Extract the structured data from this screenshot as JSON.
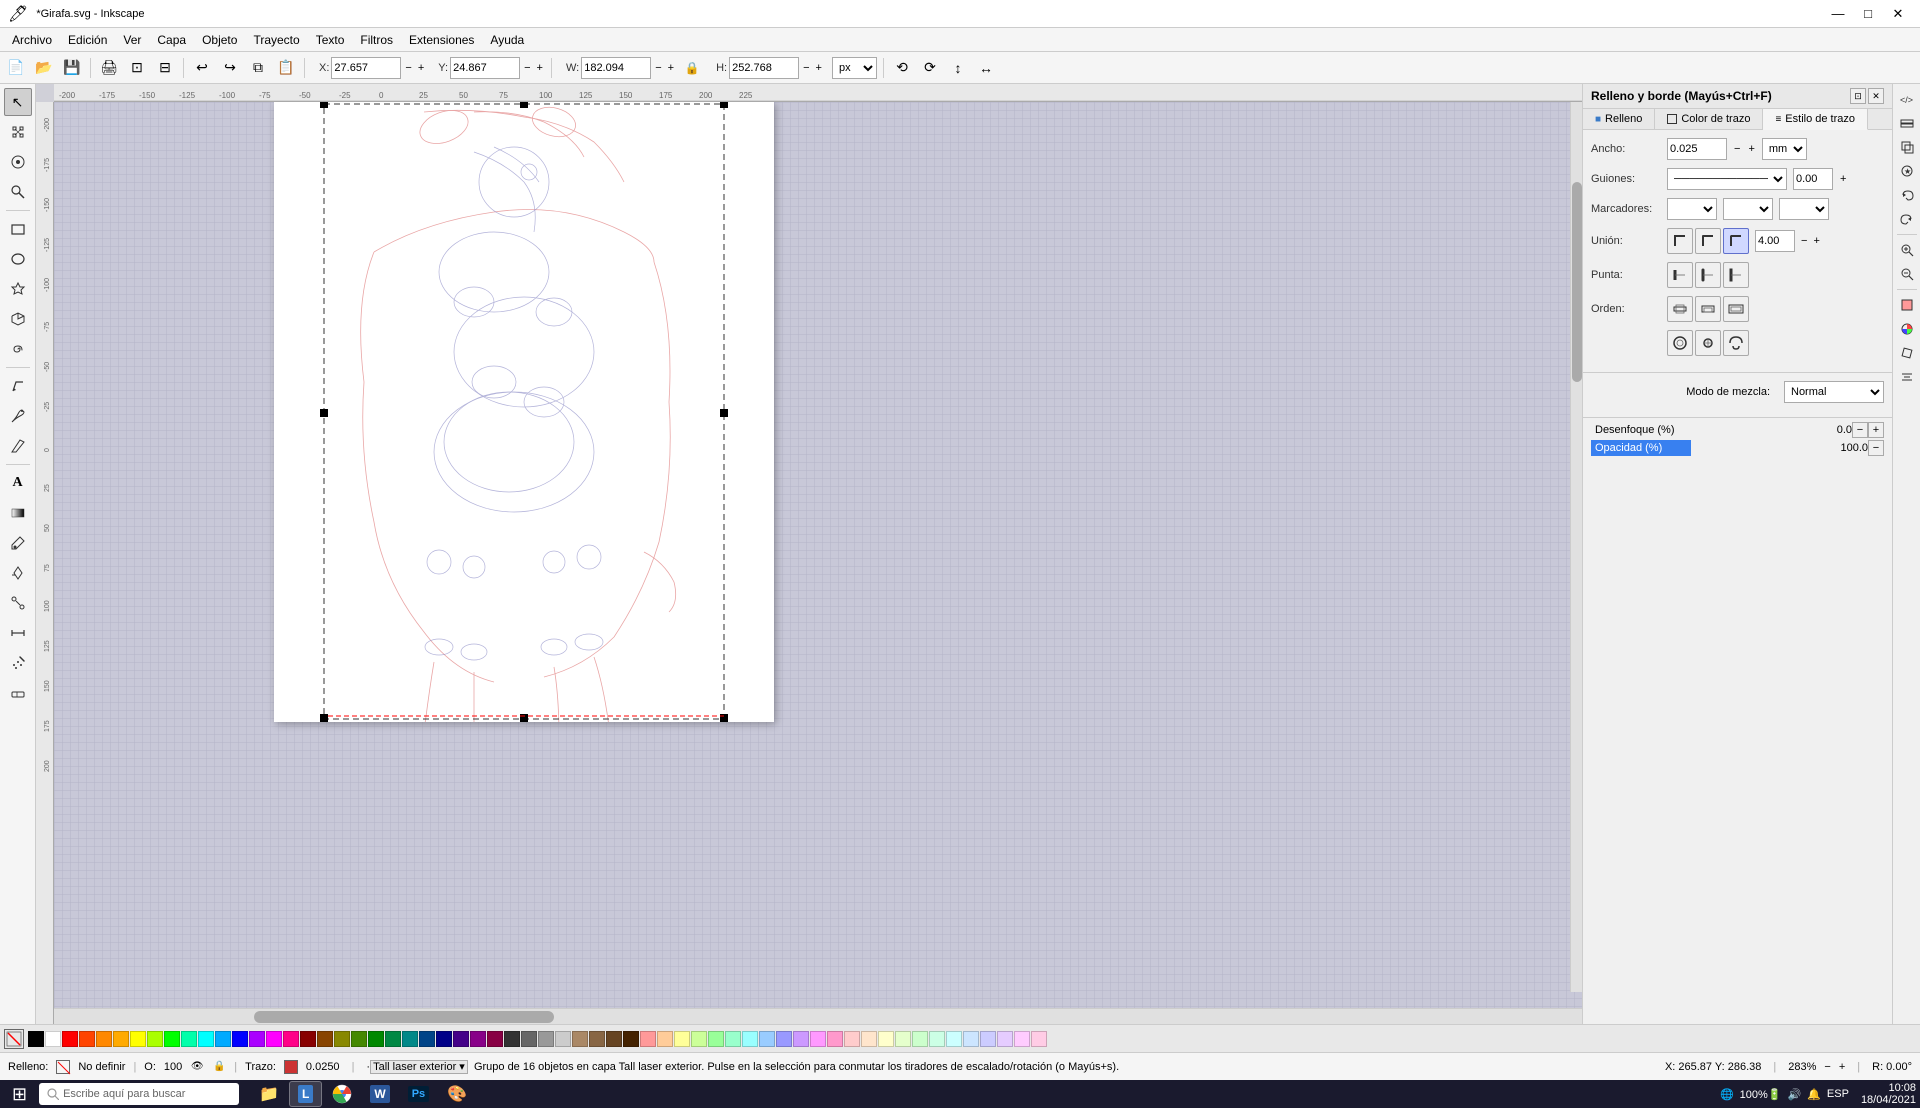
{
  "titlebar": {
    "title": "*Girafa.svg - Inkscape",
    "min_btn": "—",
    "max_btn": "□",
    "close_btn": "✕"
  },
  "menubar": {
    "items": [
      "Archivo",
      "Edición",
      "Ver",
      "Capa",
      "Objeto",
      "Trayecto",
      "Texto",
      "Filtros",
      "Extensiones",
      "Ayuda"
    ]
  },
  "toolbar": {
    "x_label": "X:",
    "x_value": "27.657",
    "y_label": "Y:",
    "y_value": "24.867",
    "w_label": "W:",
    "w_value": "182.094",
    "h_label": "H:",
    "h_value": "252.768",
    "unit": "px"
  },
  "tools": [
    {
      "name": "selector",
      "icon": "↖",
      "label": "Selector"
    },
    {
      "name": "node",
      "icon": "⬡",
      "label": "Nodo"
    },
    {
      "name": "tweak",
      "icon": "⊕",
      "label": "Tweak"
    },
    {
      "name": "zoom",
      "icon": "⊘",
      "label": "Zoom"
    },
    {
      "name": "rect",
      "icon": "□",
      "label": "Rectángulo"
    },
    {
      "name": "ellipse",
      "icon": "○",
      "label": "Elipse"
    },
    {
      "name": "star",
      "icon": "✦",
      "label": "Estrella"
    },
    {
      "name": "3d-box",
      "icon": "◱",
      "label": "Caja 3D"
    },
    {
      "name": "spiral",
      "icon": "🌀",
      "label": "Espiral"
    },
    {
      "name": "pencil",
      "icon": "✏",
      "label": "Lápiz"
    },
    {
      "name": "pen",
      "icon": "✒",
      "label": "Pluma"
    },
    {
      "name": "calligraphy",
      "icon": "∥",
      "label": "Caligrafía"
    },
    {
      "name": "text",
      "icon": "A",
      "label": "Texto"
    },
    {
      "name": "gradient",
      "icon": "▦",
      "label": "Degradado"
    },
    {
      "name": "dropper",
      "icon": "💧",
      "label": "Cuentagotas"
    },
    {
      "name": "paint-bucket",
      "icon": "🪣",
      "label": "Bote"
    },
    {
      "name": "connector",
      "icon": "⊸",
      "label": "Conector"
    },
    {
      "name": "measure",
      "icon": "↔",
      "label": "Medida"
    },
    {
      "name": "spray",
      "icon": "🔫",
      "label": "Spray"
    },
    {
      "name": "eraser",
      "icon": "⌫",
      "label": "Borrador"
    }
  ],
  "panel": {
    "title": "Relleno y borde (Mayús+Ctrl+F)",
    "tabs": [
      {
        "label": "Relleno",
        "active": false
      },
      {
        "label": "Color de trazo",
        "active": false
      },
      {
        "label": "Estilo de trazo",
        "active": true
      }
    ],
    "ancho_label": "Ancho:",
    "ancho_value": "0.025",
    "ancho_unit": "mm",
    "guiones_label": "Guiones:",
    "guiones_value": "0.00",
    "marcadores_label": "Marcadores:",
    "union_label": "Unión:",
    "union_value": "4.00",
    "punta_label": "Punta:",
    "orden_label": "Orden:",
    "blend_label": "Modo de mezcla:",
    "blend_value": "Normal",
    "desenfoque_label": "Desenfoque (%)",
    "desenfoque_value": "0.0",
    "opacidad_label": "Opacidad (%)",
    "opacidad_value": "100.0"
  },
  "status": {
    "fill_label": "Relleno:",
    "fill_text": "No definir",
    "opacity_label": "O:",
    "opacity_value": "100",
    "trazo_label": "Trazo:",
    "trazo_value": "0.0250",
    "group_info": "·Tall laser exterior ▾  Grupo de 16 objetos en capa  Tall laser exterior.  Pulse en la selección para conmutar los tiradores de escalado/rotación (o Mayús+s).",
    "coords": "X: 265.87   Y: 286.38",
    "zoom": "283%",
    "rotation": "R: 0.00°"
  },
  "palette": {
    "no_fill": "✕",
    "colors": [
      "#000000",
      "#ffffff",
      "#ff0000",
      "#ff4400",
      "#ff8800",
      "#ffaa00",
      "#ffff00",
      "#aaff00",
      "#00ff00",
      "#00ffaa",
      "#00ffff",
      "#00aaff",
      "#0000ff",
      "#aa00ff",
      "#ff00ff",
      "#ff0088",
      "#880000",
      "#884400",
      "#888800",
      "#448800",
      "#008800",
      "#008844",
      "#008888",
      "#004488",
      "#000088",
      "#440088",
      "#880088",
      "#880044",
      "#333333",
      "#666666",
      "#999999",
      "#cccccc",
      "#aa8866",
      "#886644",
      "#664422",
      "#442200",
      "#ff9999",
      "#ffcc99",
      "#ffff99",
      "#ccff99",
      "#99ff99",
      "#99ffcc",
      "#99ffff",
      "#99ccff",
      "#9999ff",
      "#cc99ff",
      "#ff99ff",
      "#ff99cc",
      "#ffcccc",
      "#ffe5cc",
      "#ffffcc",
      "#e5ffcc",
      "#ccffcc",
      "#ccffe5",
      "#ccffff",
      "#cce5ff",
      "#ccccff",
      "#e5ccff",
      "#ffccff",
      "#ffcce5"
    ]
  },
  "taskbar": {
    "start_label": "⊞",
    "search_placeholder": "Escribe aquí para buscar",
    "apps": [
      {
        "name": "explorer",
        "icon": "📁"
      },
      {
        "name": "inkscape",
        "icon": "L",
        "active": true
      },
      {
        "name": "chrome",
        "icon": "🌐"
      },
      {
        "name": "word",
        "icon": "W"
      },
      {
        "name": "photoshop",
        "icon": "Ps"
      },
      {
        "name": "app6",
        "icon": "🎨"
      }
    ],
    "tray": {
      "battery": "100%",
      "time": "10:08",
      "date": "18/04/2021",
      "lang": "ESP"
    }
  }
}
